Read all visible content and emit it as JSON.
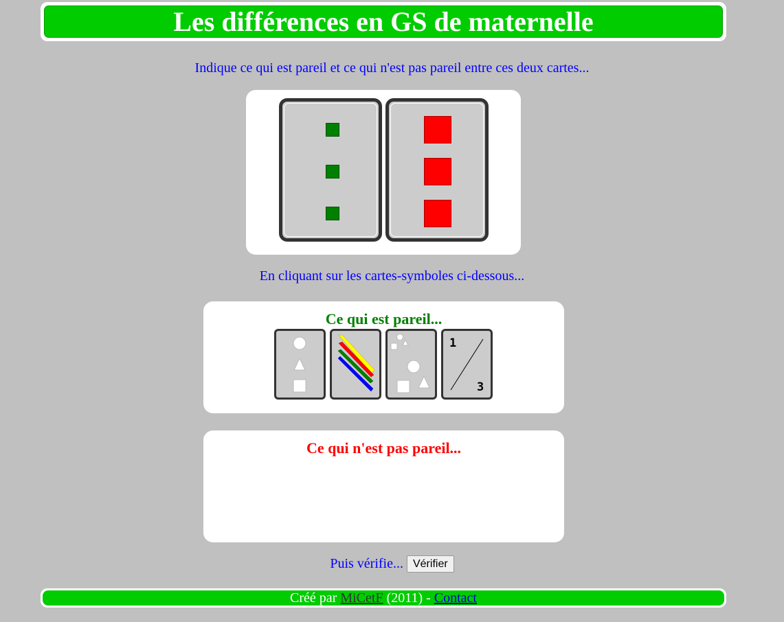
{
  "header": {
    "title": "Les différences en GS de maternelle"
  },
  "instruction": "Indique ce qui est pareil et ce qui n'est pas pareil entre ces deux cartes...",
  "cards": [
    {
      "color": "#008000",
      "count": 3,
      "size": "small"
    },
    {
      "color": "#ff0000",
      "count": 3,
      "size": "big"
    }
  ],
  "click_hint": "En cliquant sur les cartes-symboles ci-dessous...",
  "same_panel": {
    "title": "Ce qui est pareil...",
    "title_color": "#008000",
    "symbols": [
      "shapes-icon",
      "colors-icon",
      "size-icon",
      "number-icon"
    ],
    "number_card": {
      "top": "1",
      "bottom": "3"
    }
  },
  "diff_panel": {
    "title": "Ce qui n'est pas pareil...",
    "title_color": "#ff0000"
  },
  "verify": {
    "label": "Puis vérifie...",
    "button": "Vérifier"
  },
  "footer": {
    "prefix": "Créé par",
    "author": "MiCetF",
    "year": "(2011) -",
    "contact": "Contact"
  }
}
